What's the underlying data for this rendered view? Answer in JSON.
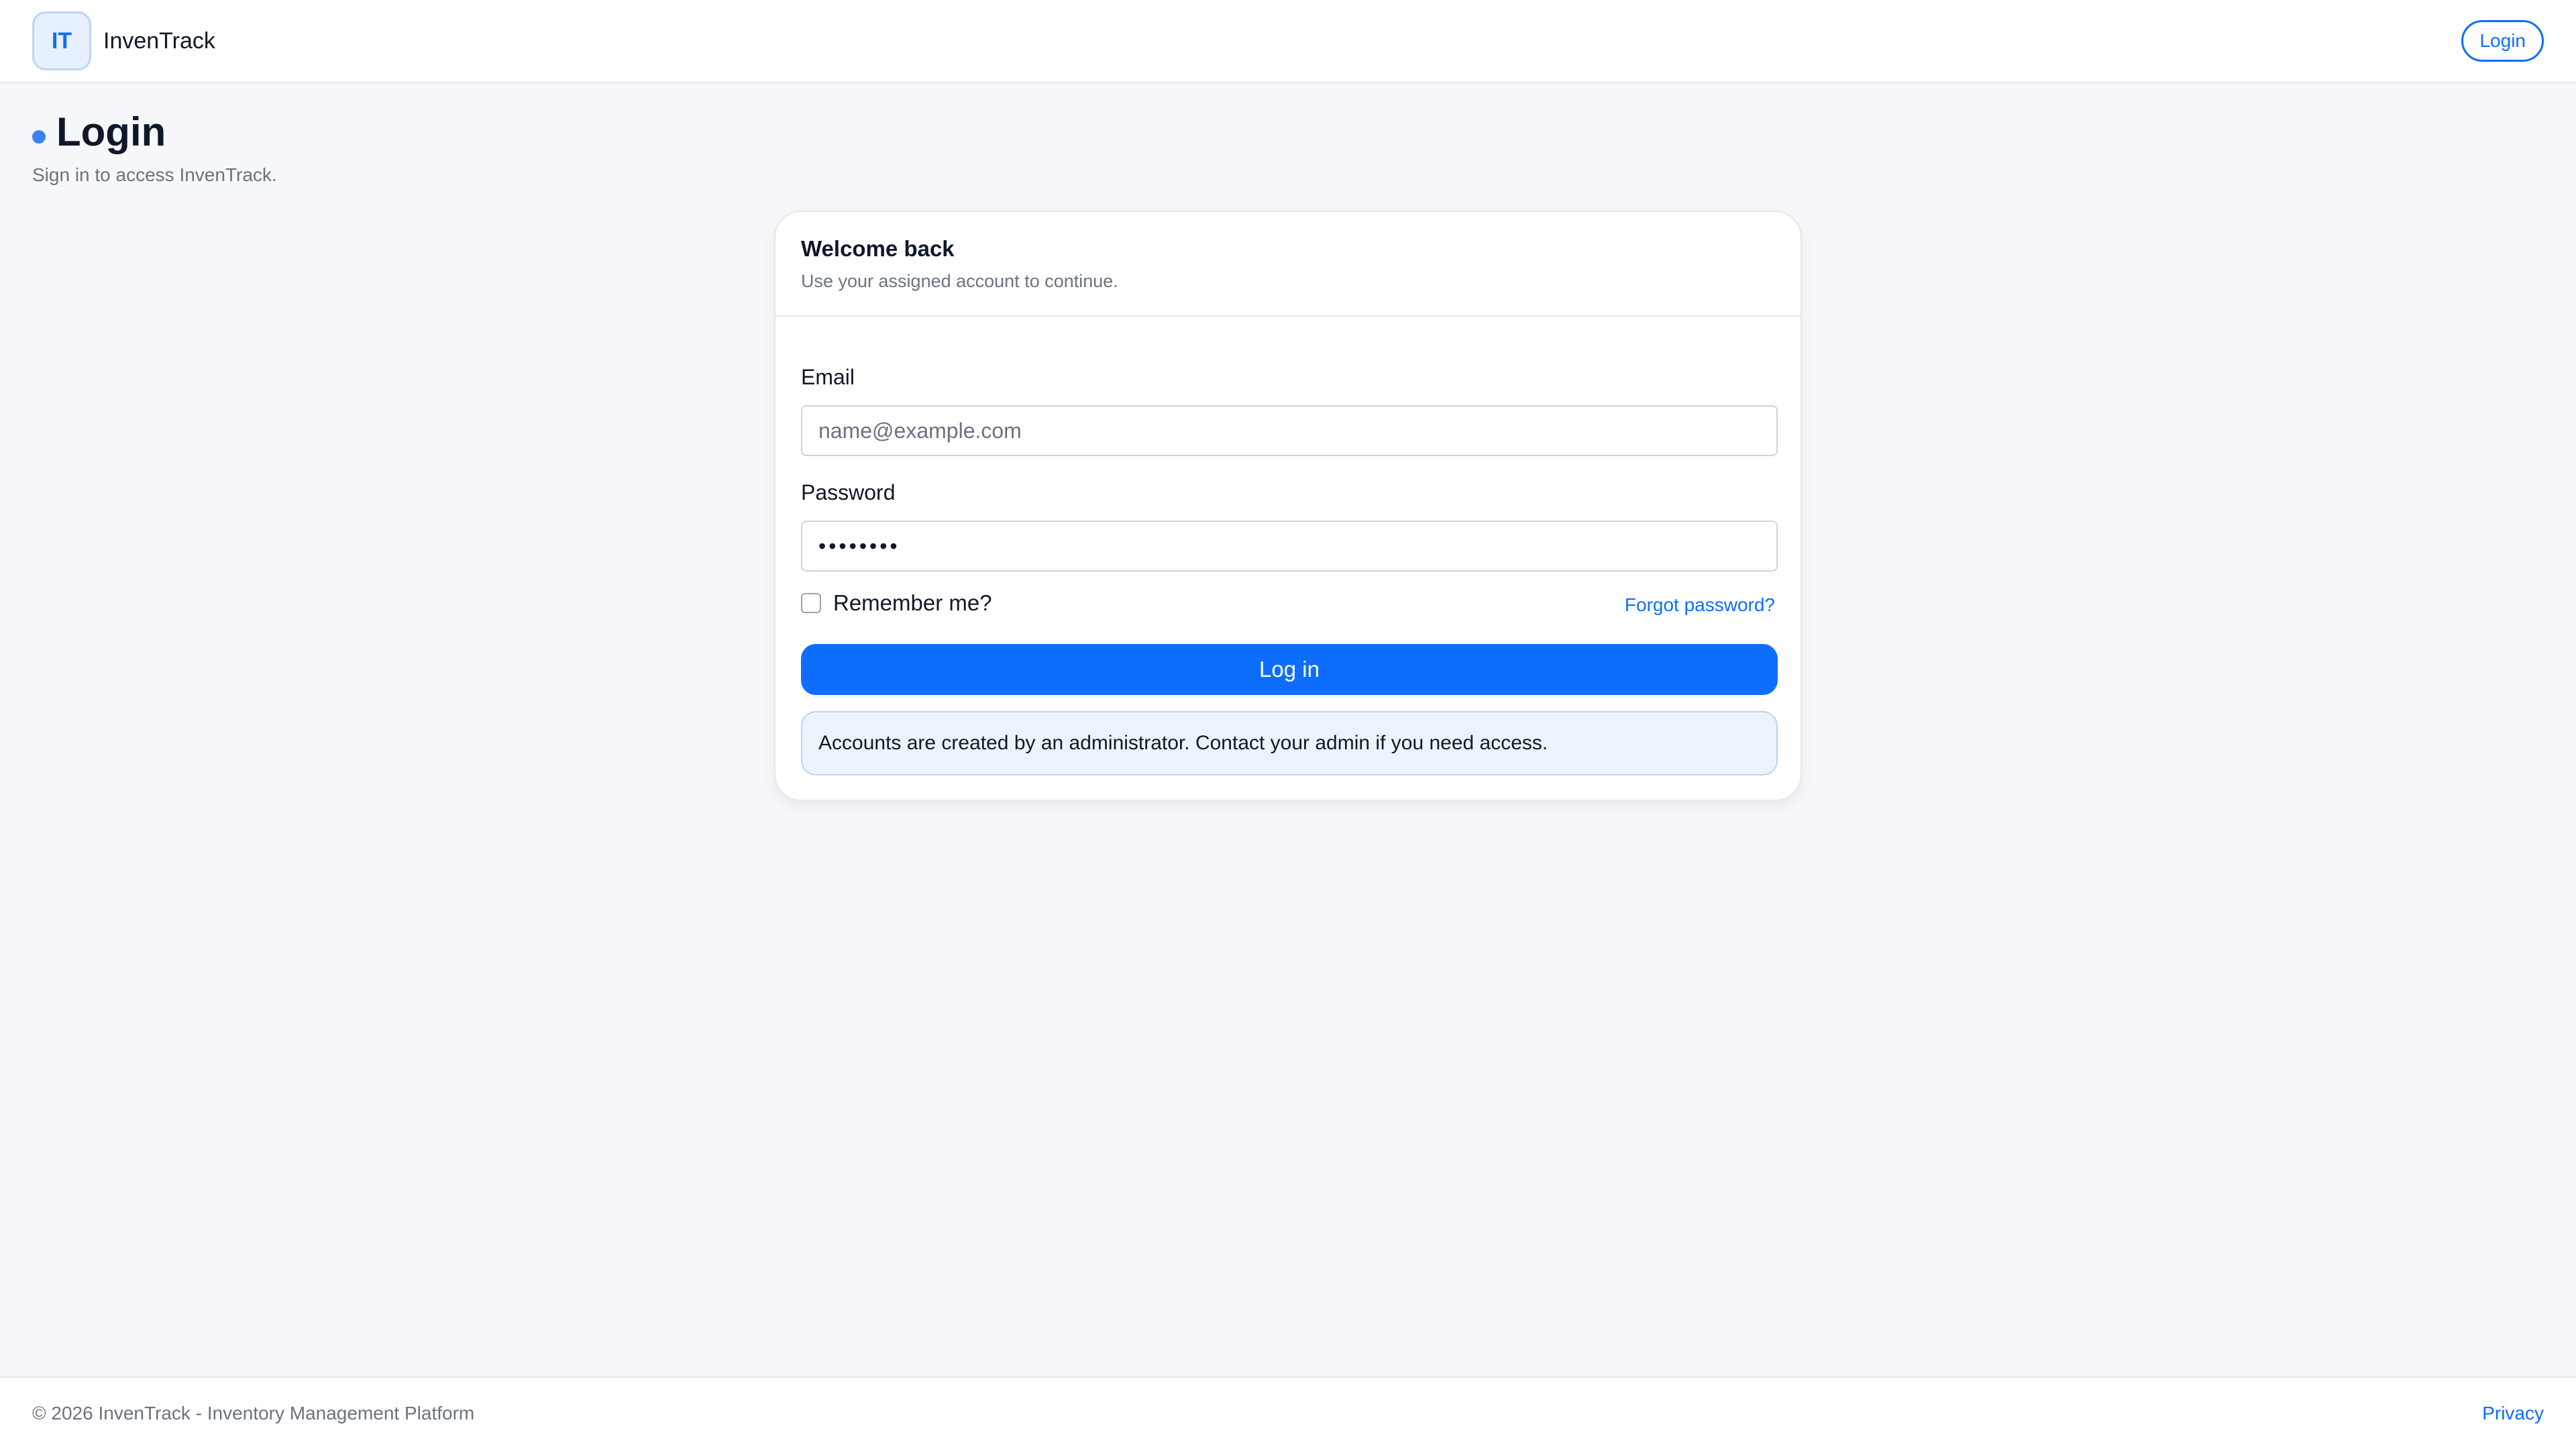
{
  "header": {
    "logo_text": "IT",
    "brand_name": "InvenTrack",
    "login_label": "Login"
  },
  "page": {
    "title": "Login",
    "subtitle": "Sign in to access InvenTrack."
  },
  "card": {
    "title": "Welcome back",
    "subtitle": "Use your assigned account to continue.",
    "email_label": "Email",
    "email_placeholder": "name@example.com",
    "email_value": "",
    "password_label": "Password",
    "password_value": "••••••••",
    "remember_label": "Remember me?",
    "remember_checked": false,
    "forgot_label": "Forgot password?",
    "submit_label": "Log in",
    "info_text": "Accounts are created by an administrator. Contact your admin if you need access."
  },
  "footer": {
    "copyright": "© 2026 InvenTrack - Inventory Management Platform",
    "privacy_label": "Privacy"
  },
  "colors": {
    "primary": "#0d6efd",
    "background": "#f6f8fb",
    "info_background": "#ecf3fd",
    "title_dot": "#3b82f6"
  }
}
